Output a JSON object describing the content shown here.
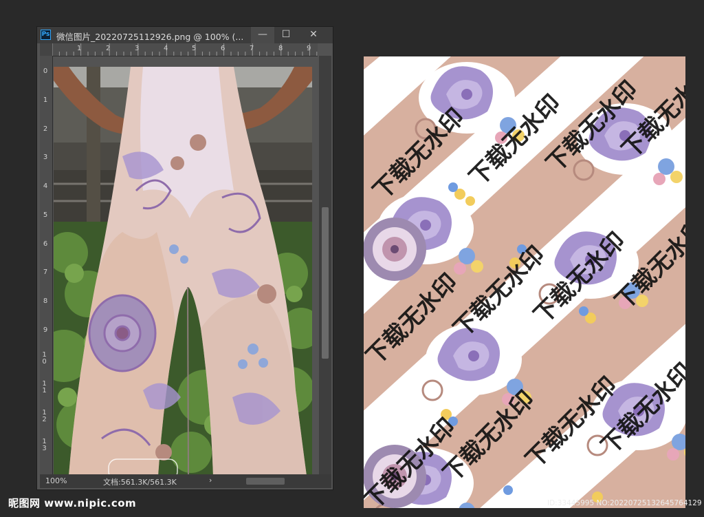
{
  "window": {
    "app_icon": "Ps",
    "title": "微信图片_20220725112926.png @ 100% (...",
    "minimize_label": "—",
    "maximize_label": "☐",
    "close_label": "✕"
  },
  "rulers": {
    "horizontal": [
      "1",
      "2",
      "3",
      "4",
      "5",
      "6",
      "7",
      "8",
      "9"
    ],
    "vertical": [
      "0",
      "1",
      "2",
      "3",
      "4",
      "5",
      "6",
      "7",
      "8",
      "9",
      "10",
      "11",
      "12",
      "13"
    ]
  },
  "status": {
    "zoom": "100%",
    "doc_info": "文档:561.3K/561.3K",
    "arrow": "›"
  },
  "watermark_text": "下载无水印",
  "footer": {
    "logo": "昵图网 www.nipic.com",
    "id_line": "ID:33445995 NO:20220725132645764129"
  },
  "colors": {
    "background": "#292929",
    "pattern_base": "#d7b09f",
    "paisley_purple": "#a693cf",
    "accent_blue": "#31a8ff"
  }
}
